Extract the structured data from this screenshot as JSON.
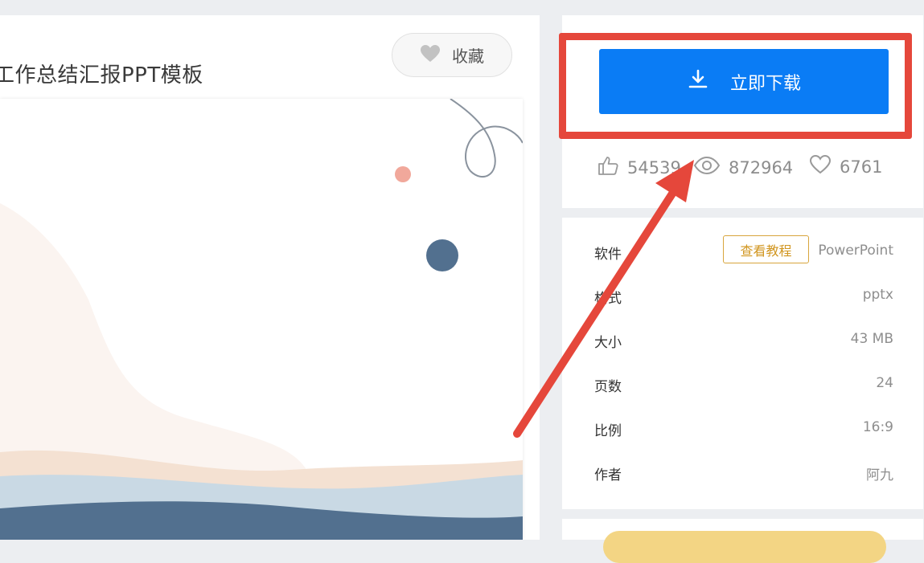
{
  "template": {
    "title": "工作总结汇报PPT模板",
    "favorite_label": "收藏"
  },
  "download": {
    "button_label": "立即下载",
    "stats": {
      "likes": "54539",
      "views": "872964",
      "favorites": "6761"
    }
  },
  "info": {
    "tutorial_label": "查看教程",
    "rows": [
      {
        "label": "软件",
        "value": "PowerPoint"
      },
      {
        "label": "格式",
        "value": "pptx"
      },
      {
        "label": "大小",
        "value": "43 MB"
      },
      {
        "label": "页数",
        "value": "24"
      },
      {
        "label": "比例",
        "value": "16:9"
      },
      {
        "label": "作者",
        "value": "阿九"
      }
    ]
  },
  "colors": {
    "accent_blue": "#0a7cf5",
    "annotation_red": "#e5473b",
    "tutorial_gold": "#d19620"
  }
}
